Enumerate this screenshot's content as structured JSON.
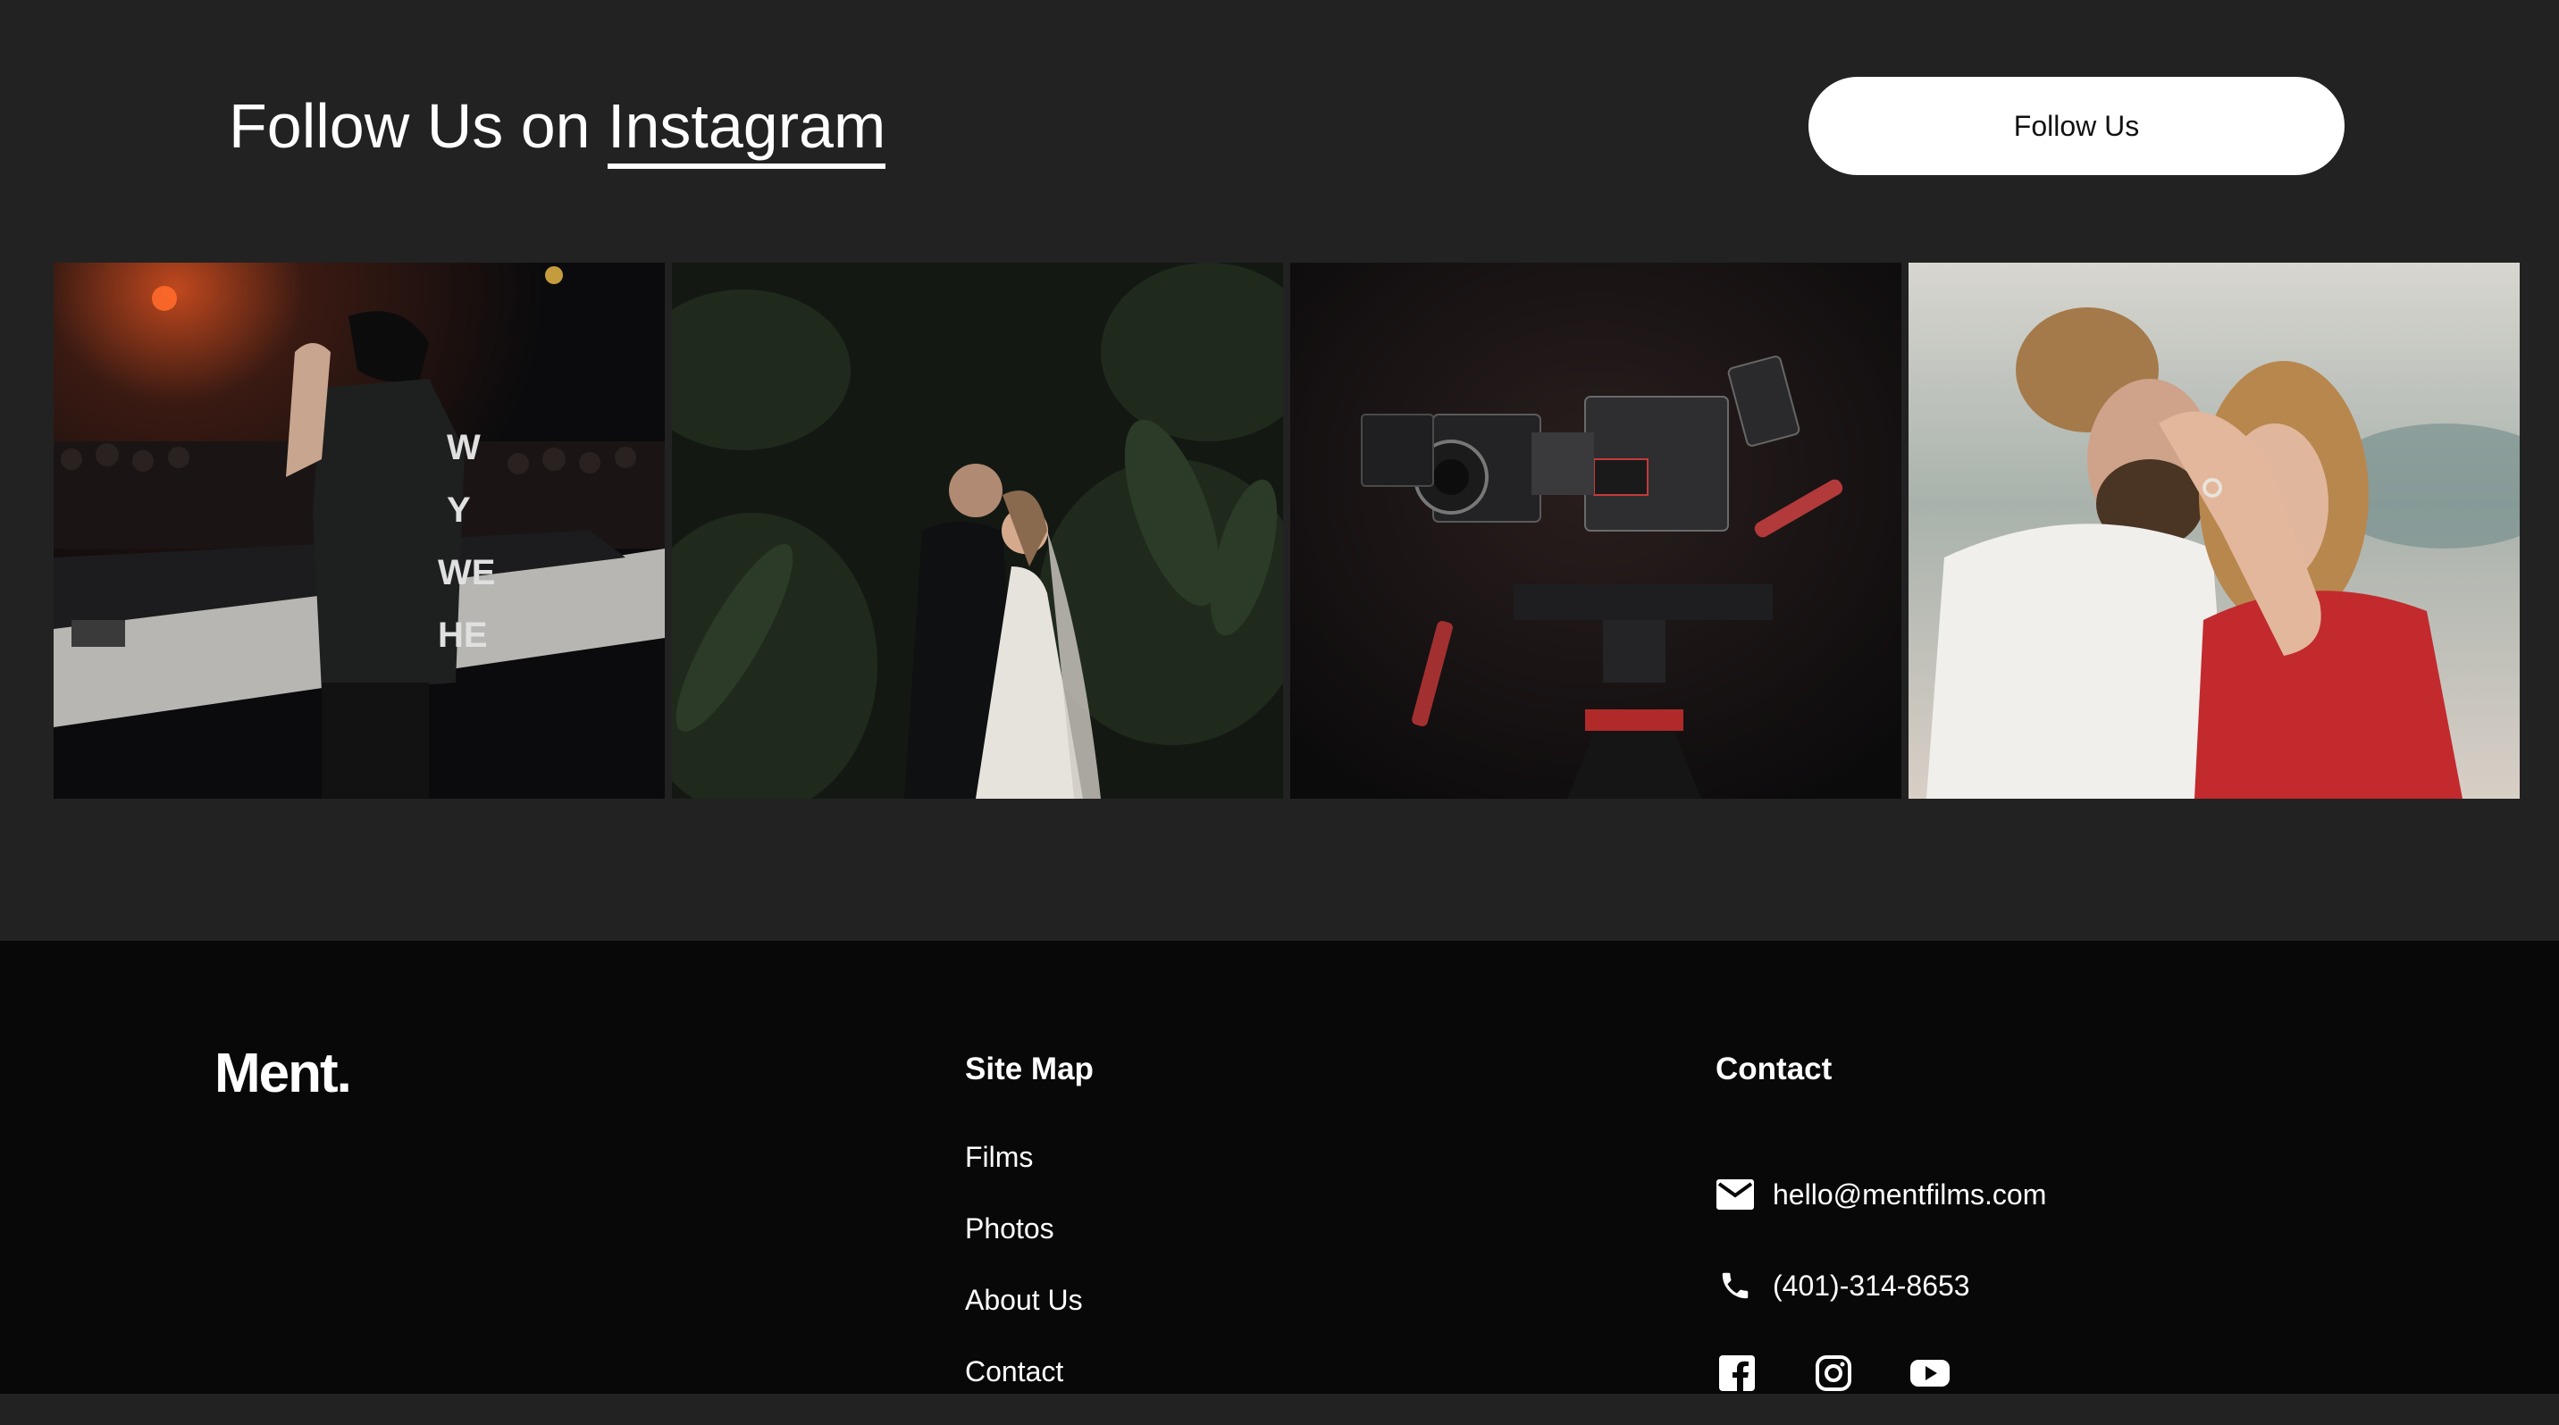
{
  "instagram": {
    "heading_prefix": "Follow Us on ",
    "heading_link": "Instagram",
    "follow_button": "Follow Us",
    "photos": [
      {
        "icon": "dj-performer-photo"
      },
      {
        "icon": "wedding-couple-photo"
      },
      {
        "icon": "cinema-camera-photo"
      },
      {
        "icon": "engagement-ring-photo"
      }
    ]
  },
  "footer": {
    "logo": "Ment.",
    "sitemap": {
      "title": "Site Map",
      "items": [
        "Films",
        "Photos",
        "About Us",
        "Contact"
      ]
    },
    "contact": {
      "title": "Contact",
      "email": "hello@mentfilms.com",
      "phone": "(401)-314-8653",
      "socials": [
        "facebook-icon",
        "instagram-icon",
        "youtube-icon"
      ]
    }
  },
  "colors": {
    "section_bg": "#222222",
    "footer_bg": "#080808",
    "text": "#ffffff",
    "button_bg": "#ffffff",
    "button_text": "#111111"
  }
}
